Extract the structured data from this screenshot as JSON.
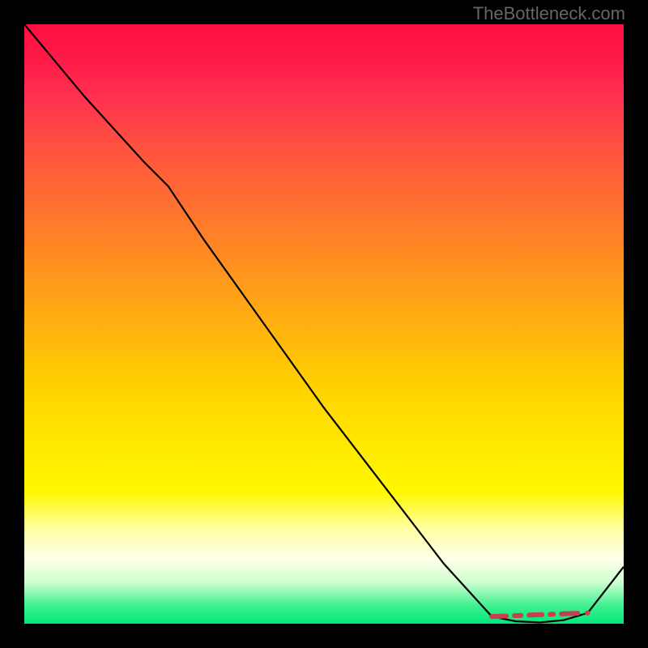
{
  "watermark": "TheBottleneck.com",
  "chart_data": {
    "type": "line",
    "title": "",
    "xlabel": "",
    "ylabel": "",
    "x": [
      0.0,
      0.1,
      0.2,
      0.24,
      0.3,
      0.4,
      0.5,
      0.6,
      0.7,
      0.78,
      0.82,
      0.86,
      0.9,
      0.94,
      1.0
    ],
    "y": [
      1.0,
      0.88,
      0.77,
      0.73,
      0.64,
      0.5,
      0.36,
      0.23,
      0.1,
      0.012,
      0.004,
      0.002,
      0.006,
      0.018,
      0.095
    ],
    "xlim": [
      0,
      1
    ],
    "ylim": [
      0,
      1
    ],
    "annotations": {
      "dashed_segment": {
        "x": [
          0.78,
          0.94
        ],
        "y": [
          0.012,
          0.018
        ]
      }
    }
  }
}
